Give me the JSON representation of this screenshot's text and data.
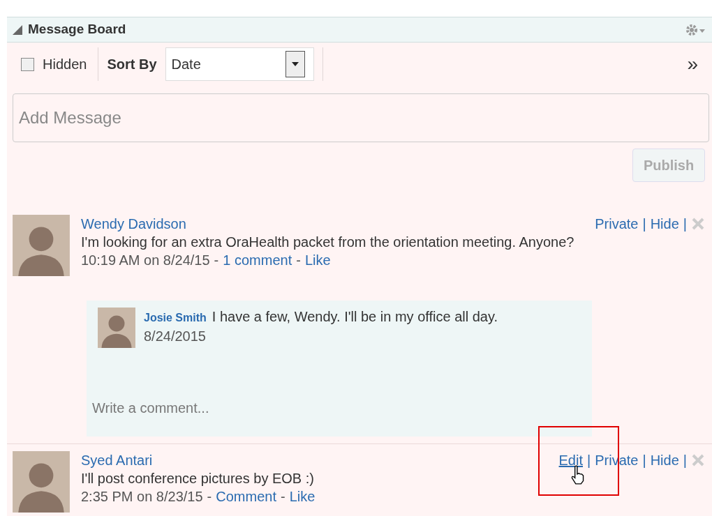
{
  "panel": {
    "title": "Message Board",
    "expanded": true
  },
  "toolbar": {
    "hidden_checkbox": {
      "label": "Hidden",
      "checked": false
    },
    "sort_label": "Sort By",
    "sort_value": "Date",
    "overflow": "»"
  },
  "composer": {
    "placeholder": "Add Message",
    "publish": {
      "label": "Publish",
      "disabled": true
    }
  },
  "separators": {
    "meta": "-",
    "actions": "|"
  },
  "posts": [
    {
      "author": "Wendy Davidson",
      "text": "I'm looking for an extra OraHealth packet from the orientation meeting. Anyone?",
      "time": "10:19 AM on 8/24/15",
      "links": [
        "1 comment",
        "Like"
      ],
      "actions": [
        {
          "label": "Private",
          "hovered": false
        },
        {
          "label": "Hide",
          "hovered": false
        }
      ],
      "comments": [
        {
          "author": "Josie Smith",
          "text": "I have a few, Wendy. I'll be in my office all day.",
          "date": "8/24/2015"
        }
      ],
      "comment_placeholder": "Write a comment..."
    },
    {
      "author": "Syed Antari",
      "text": "I'll post conference pictures by EOB :)",
      "time": "2:35 PM on 8/23/15",
      "links": [
        "Comment",
        "Like"
      ],
      "actions": [
        {
          "label": "Edit",
          "hovered": true
        },
        {
          "label": "Private",
          "hovered": false
        },
        {
          "label": "Hide",
          "hovered": false
        }
      ]
    }
  ]
}
